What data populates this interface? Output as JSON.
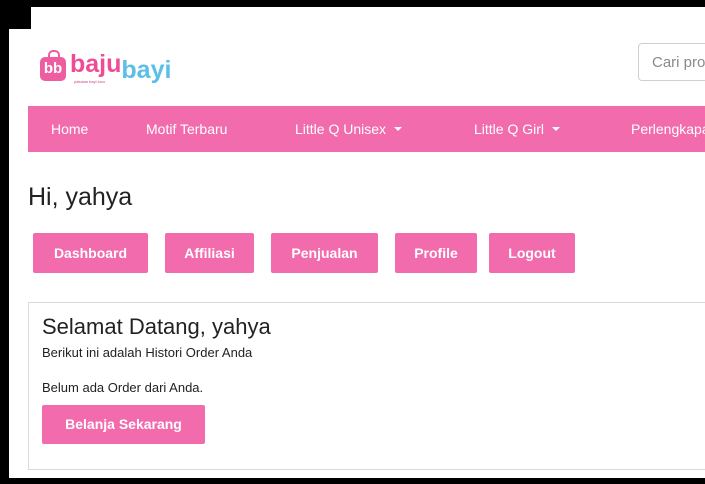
{
  "header": {
    "logo": {
      "badge": "bb",
      "text_part1": "baju",
      "text_part2": "bayi",
      "tagline": "pakaian bayi lucu"
    },
    "search": {
      "placeholder": "Cari produk"
    }
  },
  "nav": {
    "items": [
      {
        "label": "Home",
        "dropdown": false
      },
      {
        "label": "Motif Terbaru",
        "dropdown": false
      },
      {
        "label": "Little Q Unisex",
        "dropdown": true
      },
      {
        "label": "Little Q Girl",
        "dropdown": true
      },
      {
        "label": "Perlengkapan",
        "dropdown": false
      }
    ]
  },
  "account": {
    "greeting": "Hi, yahya",
    "buttons": [
      "Dashboard",
      "Affiliasi",
      "Penjualan",
      "Profile",
      "Logout"
    ]
  },
  "panel": {
    "title": "Selamat Datang, yahya",
    "subtitle": "Berikut ini adalah Histori Order Anda",
    "empty_message": "Belum ada Order dari Anda.",
    "cta_label": "Belanja Sekarang"
  },
  "colors": {
    "brand_pink": "#f26bad",
    "logo_pink": "#ee4d96",
    "logo_blue": "#5bbfe8"
  }
}
